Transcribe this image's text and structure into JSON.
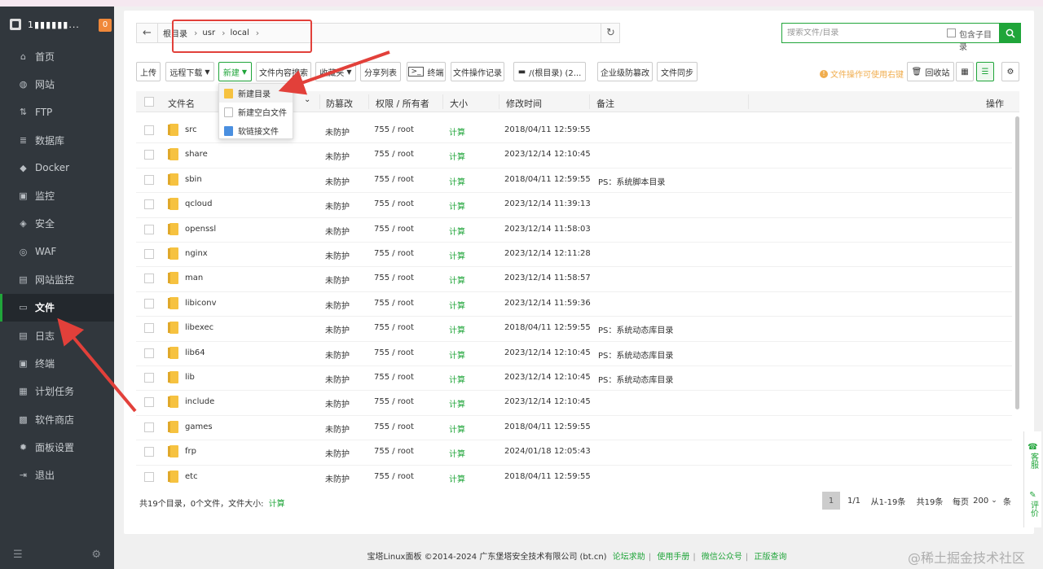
{
  "sidebar": {
    "ip": "1▮▮▮▮▮▮...",
    "badge": "0",
    "items": [
      {
        "label": "首页",
        "icon": "home-icon"
      },
      {
        "label": "网站",
        "icon": "globe-icon"
      },
      {
        "label": "FTP",
        "icon": "ftp-icon"
      },
      {
        "label": "数据库",
        "icon": "database-icon"
      },
      {
        "label": "Docker",
        "icon": "docker-icon"
      },
      {
        "label": "监控",
        "icon": "monitor-icon"
      },
      {
        "label": "安全",
        "icon": "shield-icon"
      },
      {
        "label": "WAF",
        "icon": "waf-icon"
      },
      {
        "label": "网站监控",
        "icon": "site-monitor-icon"
      },
      {
        "label": "文件",
        "icon": "folder-icon"
      },
      {
        "label": "日志",
        "icon": "log-icon"
      },
      {
        "label": "终端",
        "icon": "terminal-icon"
      },
      {
        "label": "计划任务",
        "icon": "calendar-icon"
      },
      {
        "label": "软件商店",
        "icon": "store-icon"
      },
      {
        "label": "面板设置",
        "icon": "gear-icon"
      },
      {
        "label": "退出",
        "icon": "logout-icon"
      }
    ],
    "active_index": 9
  },
  "path": {
    "crumbs": [
      "根目录",
      "usr",
      "local"
    ]
  },
  "search": {
    "placeholder": "搜索文件/目录",
    "include_sub_label": "包含子目录"
  },
  "toolbar": {
    "upload": "上传",
    "remote_download": "远程下载",
    "new": "新建",
    "content_search": "文件内容搜索",
    "favorites": "收藏夹",
    "share_list": "分享列表",
    "terminal": "终端",
    "op_log": "文件操作记录",
    "disk": "/(根目录) (2...",
    "enterprise_tamper": "企业级防篡改",
    "file_sync": "文件同步",
    "tip": "文件操作可使用右键",
    "recycle": "回收站"
  },
  "new_menu": [
    "新建目录",
    "新建空白文件",
    "软链接文件"
  ],
  "columns": [
    "文件名",
    "防篡改",
    "权限 / 所有者",
    "大小",
    "修改时间",
    "备注",
    "操作"
  ],
  "rows": [
    {
      "name": "src",
      "tamper": "未防护",
      "perm": "755 / root",
      "size": "计算",
      "mtime": "2018/04/11 12:59:55",
      "note": ""
    },
    {
      "name": "share",
      "tamper": "未防护",
      "perm": "755 / root",
      "size": "计算",
      "mtime": "2023/12/14 12:10:45",
      "note": ""
    },
    {
      "name": "sbin",
      "tamper": "未防护",
      "perm": "755 / root",
      "size": "计算",
      "mtime": "2018/04/11 12:59:55",
      "note": "PS：系统脚本目录"
    },
    {
      "name": "qcloud",
      "tamper": "未防护",
      "perm": "755 / root",
      "size": "计算",
      "mtime": "2023/12/14 11:39:13",
      "note": ""
    },
    {
      "name": "openssl",
      "tamper": "未防护",
      "perm": "755 / root",
      "size": "计算",
      "mtime": "2023/12/14 11:58:03",
      "note": ""
    },
    {
      "name": "nginx",
      "tamper": "未防护",
      "perm": "755 / root",
      "size": "计算",
      "mtime": "2023/12/14 12:11:28",
      "note": ""
    },
    {
      "name": "man",
      "tamper": "未防护",
      "perm": "755 / root",
      "size": "计算",
      "mtime": "2023/12/14 11:58:57",
      "note": ""
    },
    {
      "name": "libiconv",
      "tamper": "未防护",
      "perm": "755 / root",
      "size": "计算",
      "mtime": "2023/12/14 11:59:36",
      "note": ""
    },
    {
      "name": "libexec",
      "tamper": "未防护",
      "perm": "755 / root",
      "size": "计算",
      "mtime": "2018/04/11 12:59:55",
      "note": "PS：系统动态库目录"
    },
    {
      "name": "lib64",
      "tamper": "未防护",
      "perm": "755 / root",
      "size": "计算",
      "mtime": "2023/12/14 12:10:45",
      "note": "PS：系统动态库目录"
    },
    {
      "name": "lib",
      "tamper": "未防护",
      "perm": "755 / root",
      "size": "计算",
      "mtime": "2023/12/14 12:10:45",
      "note": "PS：系统动态库目录"
    },
    {
      "name": "include",
      "tamper": "未防护",
      "perm": "755 / root",
      "size": "计算",
      "mtime": "2023/12/14 12:10:45",
      "note": ""
    },
    {
      "name": "games",
      "tamper": "未防护",
      "perm": "755 / root",
      "size": "计算",
      "mtime": "2018/04/11 12:59:55",
      "note": ""
    },
    {
      "name": "frp",
      "tamper": "未防护",
      "perm": "755 / root",
      "size": "计算",
      "mtime": "2024/01/18 12:05:43",
      "note": ""
    },
    {
      "name": "etc",
      "tamper": "未防护",
      "perm": "755 / root",
      "size": "计算",
      "mtime": "2018/04/11 12:59:55",
      "note": ""
    }
  ],
  "summary": {
    "text": "共19个目录，0个文件，文件大小:",
    "calc": "计算"
  },
  "pagination": {
    "current": "1",
    "pages": "1/1",
    "range": "从1-19条",
    "total": "共19条",
    "per_page_prefix": "每页",
    "per_page_value": "200",
    "per_page_suffix": "条"
  },
  "footer": {
    "copyright": "宝塔Linux面板 ©2014-2024 广东堡塔安全技术有限公司 (bt.cn)",
    "links": [
      "论坛求助",
      "使用手册",
      "微信公众号",
      "正版查询"
    ]
  },
  "float": {
    "service": "客服",
    "review": "评价"
  },
  "watermark": "@稀土掘金技术社区",
  "colors": {
    "accent": "#20a53a",
    "sidebar": "#31373d",
    "annotation": "#e2403a"
  }
}
